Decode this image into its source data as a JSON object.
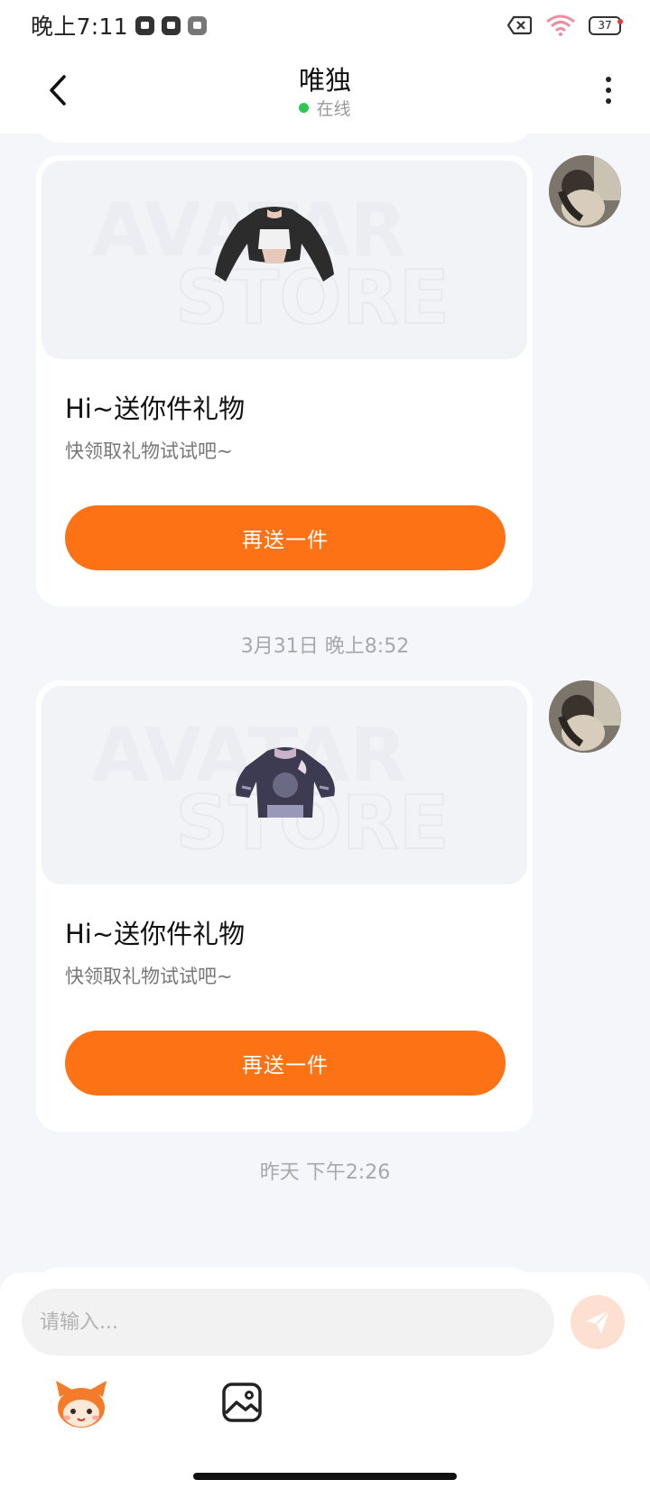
{
  "status_bar": {
    "time": "晚上7:11",
    "battery_level": "37",
    "icons": [
      "notification-icon",
      "notification-icon",
      "notification-icon",
      "sim-off-icon",
      "wifi-icon",
      "battery-icon"
    ]
  },
  "header": {
    "back_icon": "chevron-left-icon",
    "title": "唯独",
    "status": "在线",
    "status_color": "#2dc653",
    "more_icon": "more-vertical-icon"
  },
  "messages": [
    {
      "type": "gift-card",
      "watermark": [
        "AVATAR",
        "STORE"
      ],
      "gift_item": "black cropped jacket",
      "title": "Hi~送你件礼物",
      "subtitle": "快领取礼物试试吧~",
      "button_label": "再送一件"
    },
    {
      "type": "timestamp",
      "text": "3月31日 晚上8:52"
    },
    {
      "type": "gift-card",
      "watermark": [
        "AVATAR",
        "STORE"
      ],
      "gift_item": "purple graphic hoodie",
      "title": "Hi~送你件礼物",
      "subtitle": "快领取礼物试试吧~",
      "button_label": "再送一件"
    },
    {
      "type": "timestamp",
      "text": "昨天 下午2:26"
    }
  ],
  "input_bar": {
    "placeholder": "请输入...",
    "value": "",
    "send_icon": "send-icon",
    "tools": [
      "mascot-emoji-icon",
      "image-icon"
    ]
  },
  "colors": {
    "accent": "#fd7214",
    "send_button_bg": "#fde0d2",
    "background": "#f4f6fa"
  }
}
